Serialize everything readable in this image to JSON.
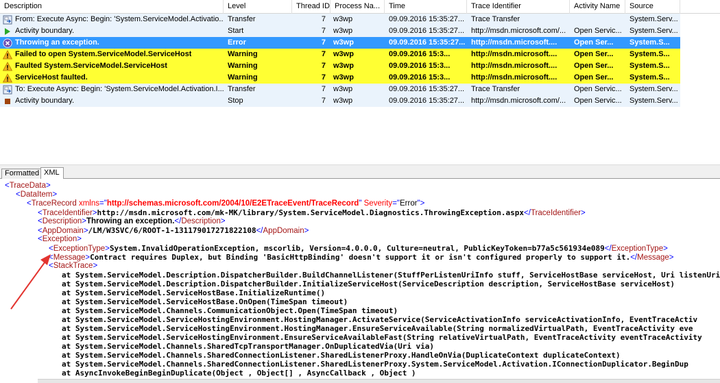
{
  "columns": {
    "description": "Description",
    "level": "Level",
    "thread": "Thread ID",
    "process": "Process Na...",
    "time": "Time",
    "trace": "Trace Identifier",
    "activity": "Activity Name",
    "source": "Source"
  },
  "rows": [
    {
      "desc": "From: Execute Async: Begin: 'System.ServiceModel.Activatio...",
      "level": "Transfer",
      "thread": "7",
      "process": "w3wp",
      "time": "09.09.2016 15:35:27...",
      "trace": "Trace Transfer",
      "activity": "",
      "source": "System.Serv...",
      "icon": "transfer-icon",
      "state": "normal"
    },
    {
      "desc": "Activity boundary.",
      "level": "Start",
      "thread": "7",
      "process": "w3wp",
      "time": "09.09.2016 15:35:27...",
      "trace": "http://msdn.microsoft.com/...",
      "activity": "Open Servic...",
      "source": "System.Serv...",
      "icon": "start-icon",
      "state": "normal"
    },
    {
      "desc": "Throwing an exception.",
      "level": "Error",
      "thread": "7",
      "process": "w3wp",
      "time": "09.09.2016 15:35:27...",
      "trace": "http://msdn.microsoft....",
      "activity": "Open Ser...",
      "source": "System.S...",
      "icon": "error-icon",
      "state": "selected"
    },
    {
      "desc": "Failed to open System.ServiceModel.ServiceHost",
      "level": "Warning",
      "thread": "7",
      "process": "w3wp",
      "time": "09.09.2016 15:3...",
      "trace": "http://msdn.microsoft....",
      "activity": "Open Ser...",
      "source": "System.S...",
      "icon": "warning-icon",
      "state": "warning"
    },
    {
      "desc": "Faulted System.ServiceModel.ServiceHost",
      "level": "Warning",
      "thread": "7",
      "process": "w3wp",
      "time": "09.09.2016 15:3...",
      "trace": "http://msdn.microsoft....",
      "activity": "Open Ser...",
      "source": "System.S...",
      "icon": "warning-icon",
      "state": "warning"
    },
    {
      "desc": "ServiceHost faulted.",
      "level": "Warning",
      "thread": "7",
      "process": "w3wp",
      "time": "09.09.2016 15:3...",
      "trace": "http://msdn.microsoft....",
      "activity": "Open Ser...",
      "source": "System.S...",
      "icon": "warning-icon",
      "state": "warning"
    },
    {
      "desc": "To: Execute Async: Begin: 'System.ServiceModel.Activation.I...",
      "level": "Transfer",
      "thread": "7",
      "process": "w3wp",
      "time": "09.09.2016 15:35:27...",
      "trace": "Trace Transfer",
      "activity": "Open Servic...",
      "source": "System.Serv...",
      "icon": "transfer-icon",
      "state": "normal"
    },
    {
      "desc": "Activity boundary.",
      "level": "Stop",
      "thread": "7",
      "process": "w3wp",
      "time": "09.09.2016 15:35:27...",
      "trace": "http://msdn.microsoft.com/...",
      "activity": "Open Servic...",
      "source": "System.Serv...",
      "icon": "stop-icon",
      "state": "normal"
    }
  ],
  "tabs": {
    "formatted": "Formatted",
    "xml": "XML"
  },
  "xml": {
    "tracedata": "TraceData",
    "dataitem": "DataItem",
    "tracerecord": "TraceRecord",
    "xmlns_attr": "xmlns",
    "xmlns_val": "http://schemas.microsoft.com/2004/10/E2ETraceEvent/TraceRecord",
    "severity_attr": "Severity",
    "severity_val": "Error",
    "traceidentifier": "TraceIdentifier",
    "traceidentifier_val": "http://msdn.microsoft.com/mk-MK/library/System.ServiceModel.Diagnostics.ThrowingException.aspx",
    "description": "Description",
    "description_val": "Throwing an exception.",
    "appdomain": "AppDomain",
    "appdomain_val": "/LM/W3SVC/6/ROOT-1-131179017271822108",
    "exception": "Exception",
    "exceptiontype": "ExceptionType",
    "exceptiontype_val": "System.InvalidOperationException, mscorlib, Version=4.0.0.0, Culture=neutral, PublicKeyToken=b77a5c561934e089",
    "message": "Message",
    "message_val": "Contract requires Duplex, but Binding 'BasicHttpBinding' doesn't support it or isn't configured properly to support it.",
    "stacktrace": "StackTrace",
    "stack": [
      "at System.ServiceModel.Description.DispatcherBuilder.BuildChannelListener(StuffPerListenUriInfo stuff, ServiceHostBase serviceHost, Uri listenUri,",
      "at System.ServiceModel.Description.DispatcherBuilder.InitializeServiceHost(ServiceDescription description, ServiceHostBase serviceHost)",
      "at System.ServiceModel.ServiceHostBase.InitializeRuntime()",
      "at System.ServiceModel.ServiceHostBase.OnOpen(TimeSpan timeout)",
      "at System.ServiceModel.Channels.CommunicationObject.Open(TimeSpan timeout)",
      "at System.ServiceModel.ServiceHostingEnvironment.HostingManager.ActivateService(ServiceActivationInfo serviceActivationInfo, EventTraceActiv",
      "at System.ServiceModel.ServiceHostingEnvironment.HostingManager.EnsureServiceAvailable(String normalizedVirtualPath, EventTraceActivity eve",
      "at System.ServiceModel.ServiceHostingEnvironment.EnsureServiceAvailableFast(String relativeVirtualPath, EventTraceActivity eventTraceActivity",
      "at System.ServiceModel.Channels.SharedTcpTransportManager.OnDuplicatedVia(Uri via)",
      "at System.ServiceModel.Channels.SharedConnectionListener.SharedListenerProxy.HandleOnVia(DuplicateContext duplicateContext)",
      "at System.ServiceModel.Channels.SharedConnectionListener.SharedListenerProxy.System.ServiceModel.Activation.IConnectionDuplicator.BeginDup",
      "at AsyncInvokeBeginBeginDuplicate(Object , Object[] , AsyncCallback , Object )"
    ]
  },
  "colors": {
    "selected": "#3399ff",
    "warning": "#ffff33",
    "row": "#eaf3fc",
    "annotation_arrow": "#e3342f"
  }
}
